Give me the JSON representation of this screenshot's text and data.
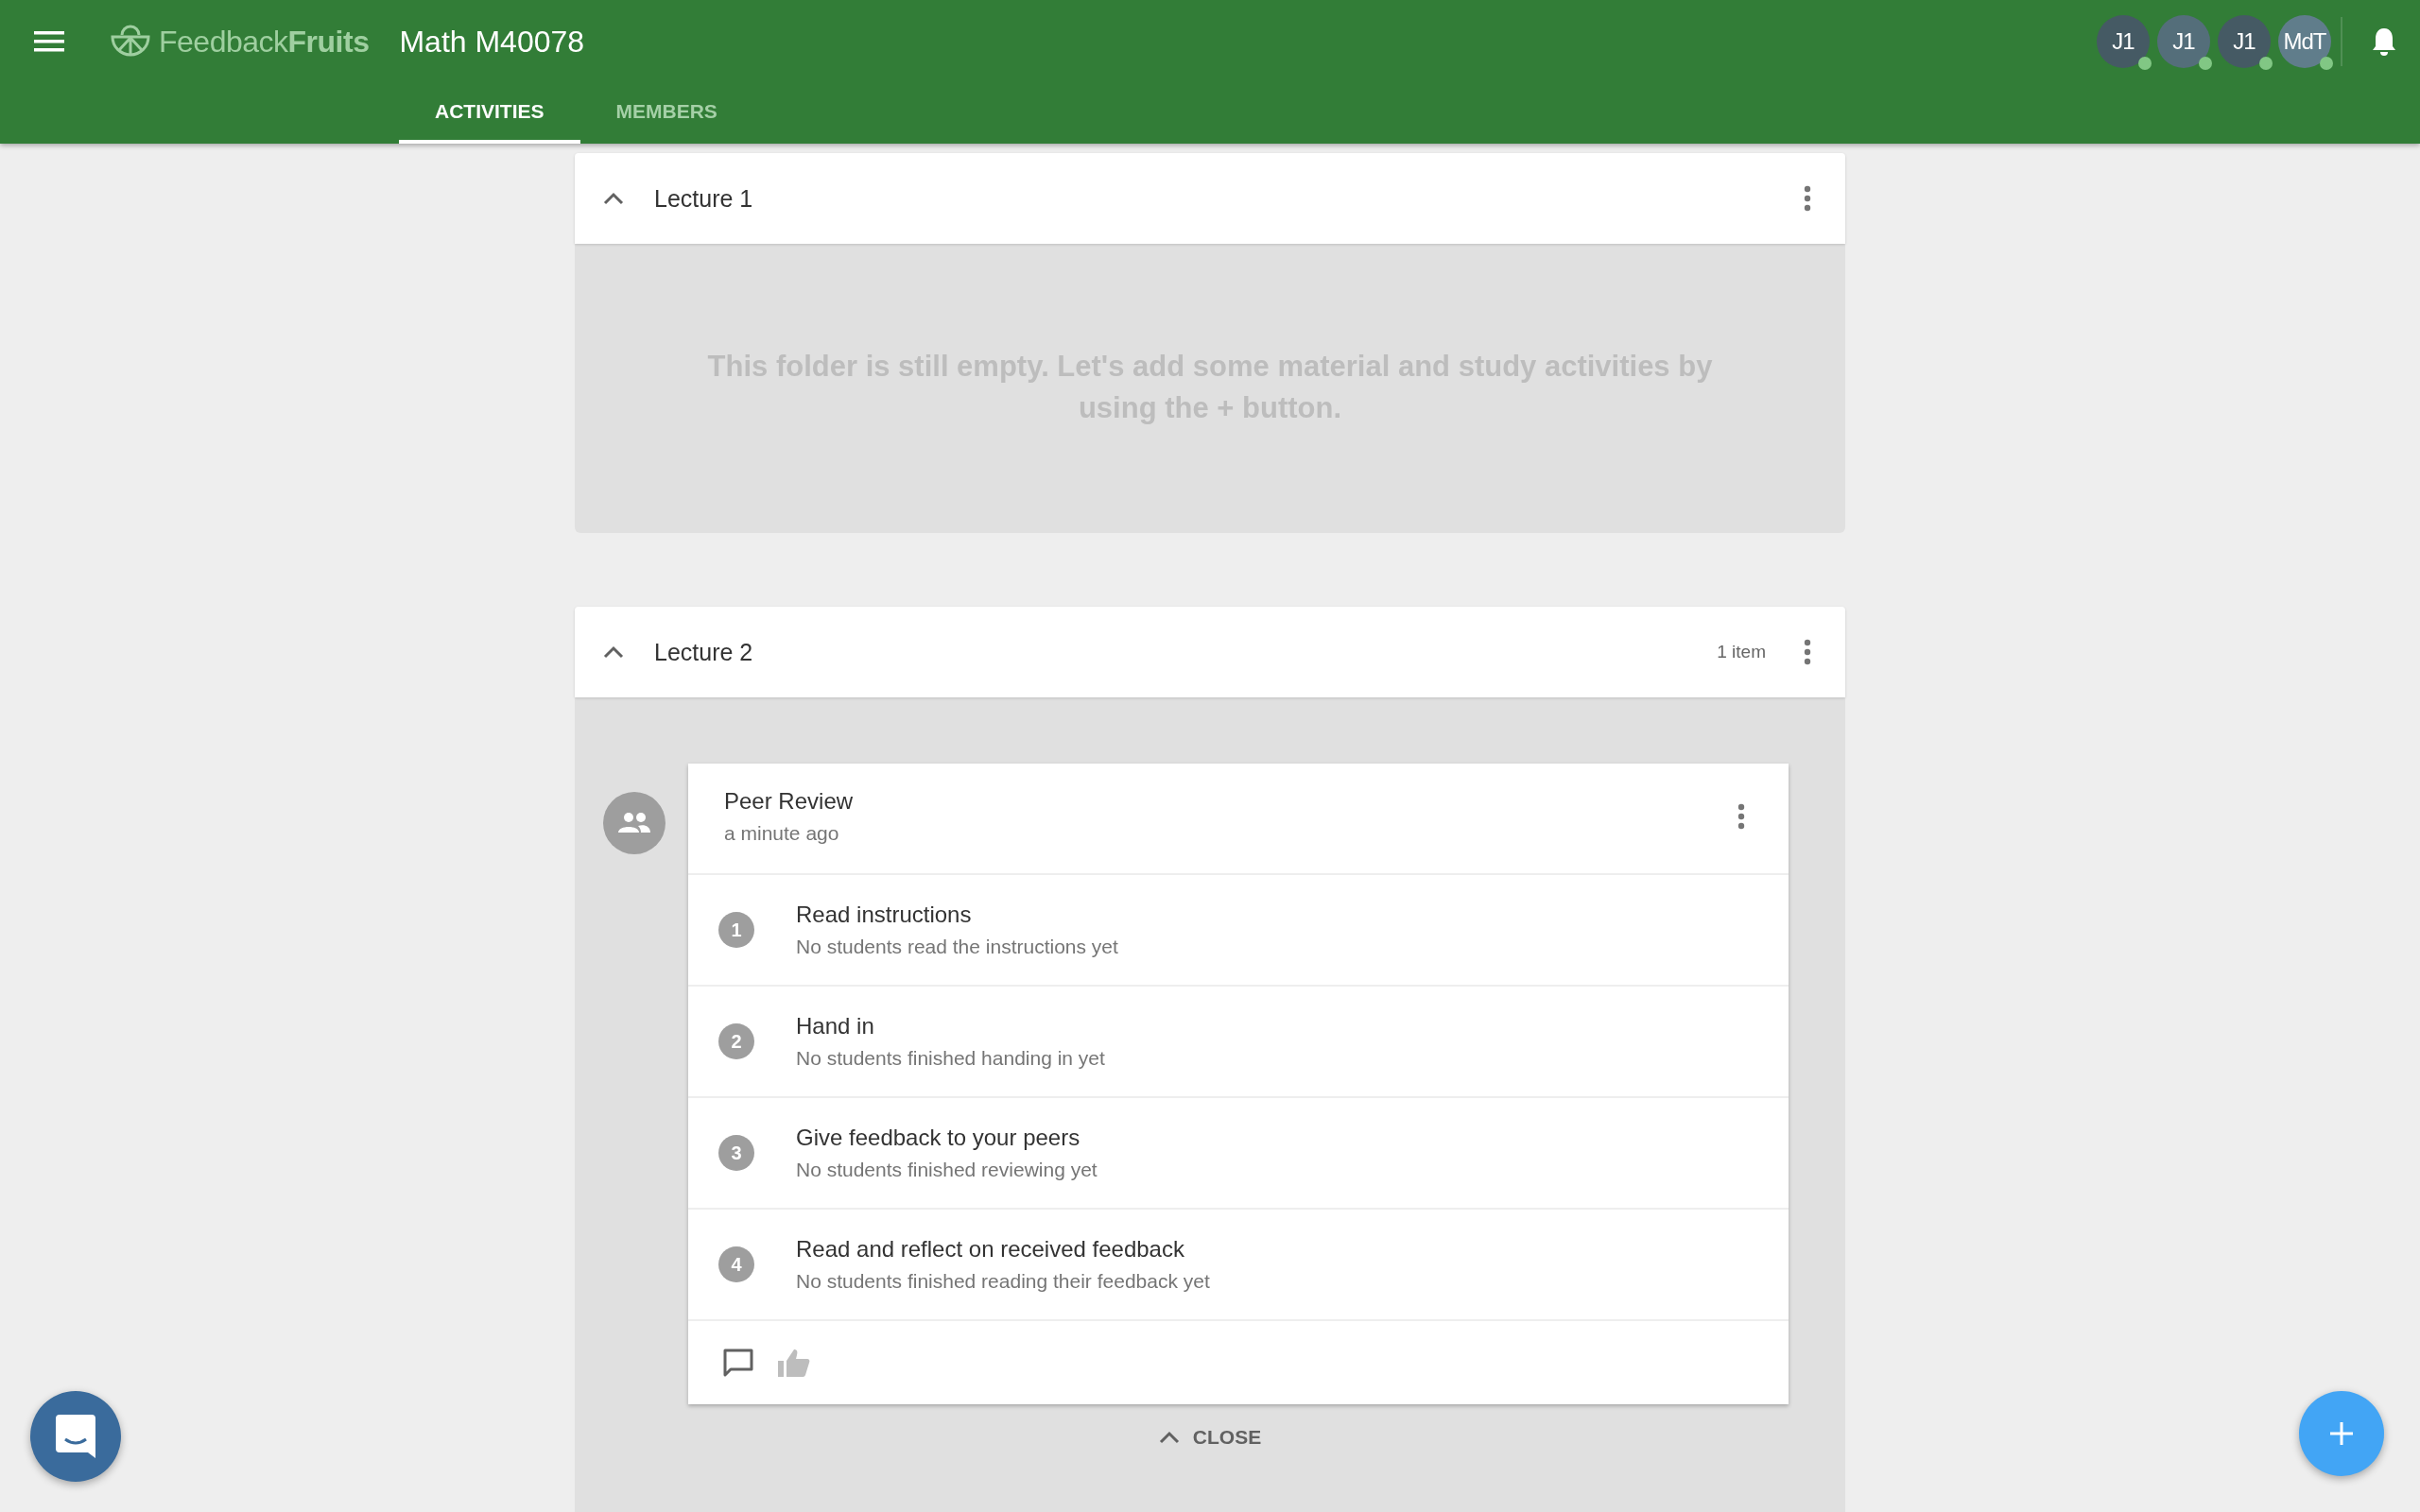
{
  "header": {
    "logo": {
      "light": "Feedback",
      "bold": "Fruits"
    },
    "course_title": "Math M40078",
    "tabs": [
      {
        "label": "ACTIVITIES",
        "selected": true
      },
      {
        "label": "MEMBERS",
        "selected": false
      }
    ],
    "members": [
      {
        "initials": "J1",
        "color": "#455a64",
        "online": true
      },
      {
        "initials": "J1",
        "color": "#546e7a",
        "online": true
      },
      {
        "initials": "J1",
        "color": "#455a64",
        "online": true
      },
      {
        "initials": "MdT",
        "color": "#607d8b",
        "online": true
      }
    ]
  },
  "folders": [
    {
      "title": "Lecture 1",
      "expanded": true,
      "empty_message": "This folder is still empty. Let's add some material and study activities by using the + button."
    },
    {
      "title": "Lecture 2",
      "expanded": true,
      "item_count": "1 item",
      "activities": [
        {
          "title": "Peer Review",
          "time": "a minute ago",
          "steps": [
            {
              "number": "1",
              "title": "Read instructions",
              "status": "No students read the instructions yet"
            },
            {
              "number": "2",
              "title": "Hand in",
              "status": "No students finished handing in yet"
            },
            {
              "number": "3",
              "title": "Give feedback to your peers",
              "status": "No students finished reviewing yet"
            },
            {
              "number": "4",
              "title": "Read and reflect on received feedback",
              "status": "No students finished reading their feedback yet"
            }
          ]
        }
      ],
      "close_label": "CLOSE"
    }
  ]
}
